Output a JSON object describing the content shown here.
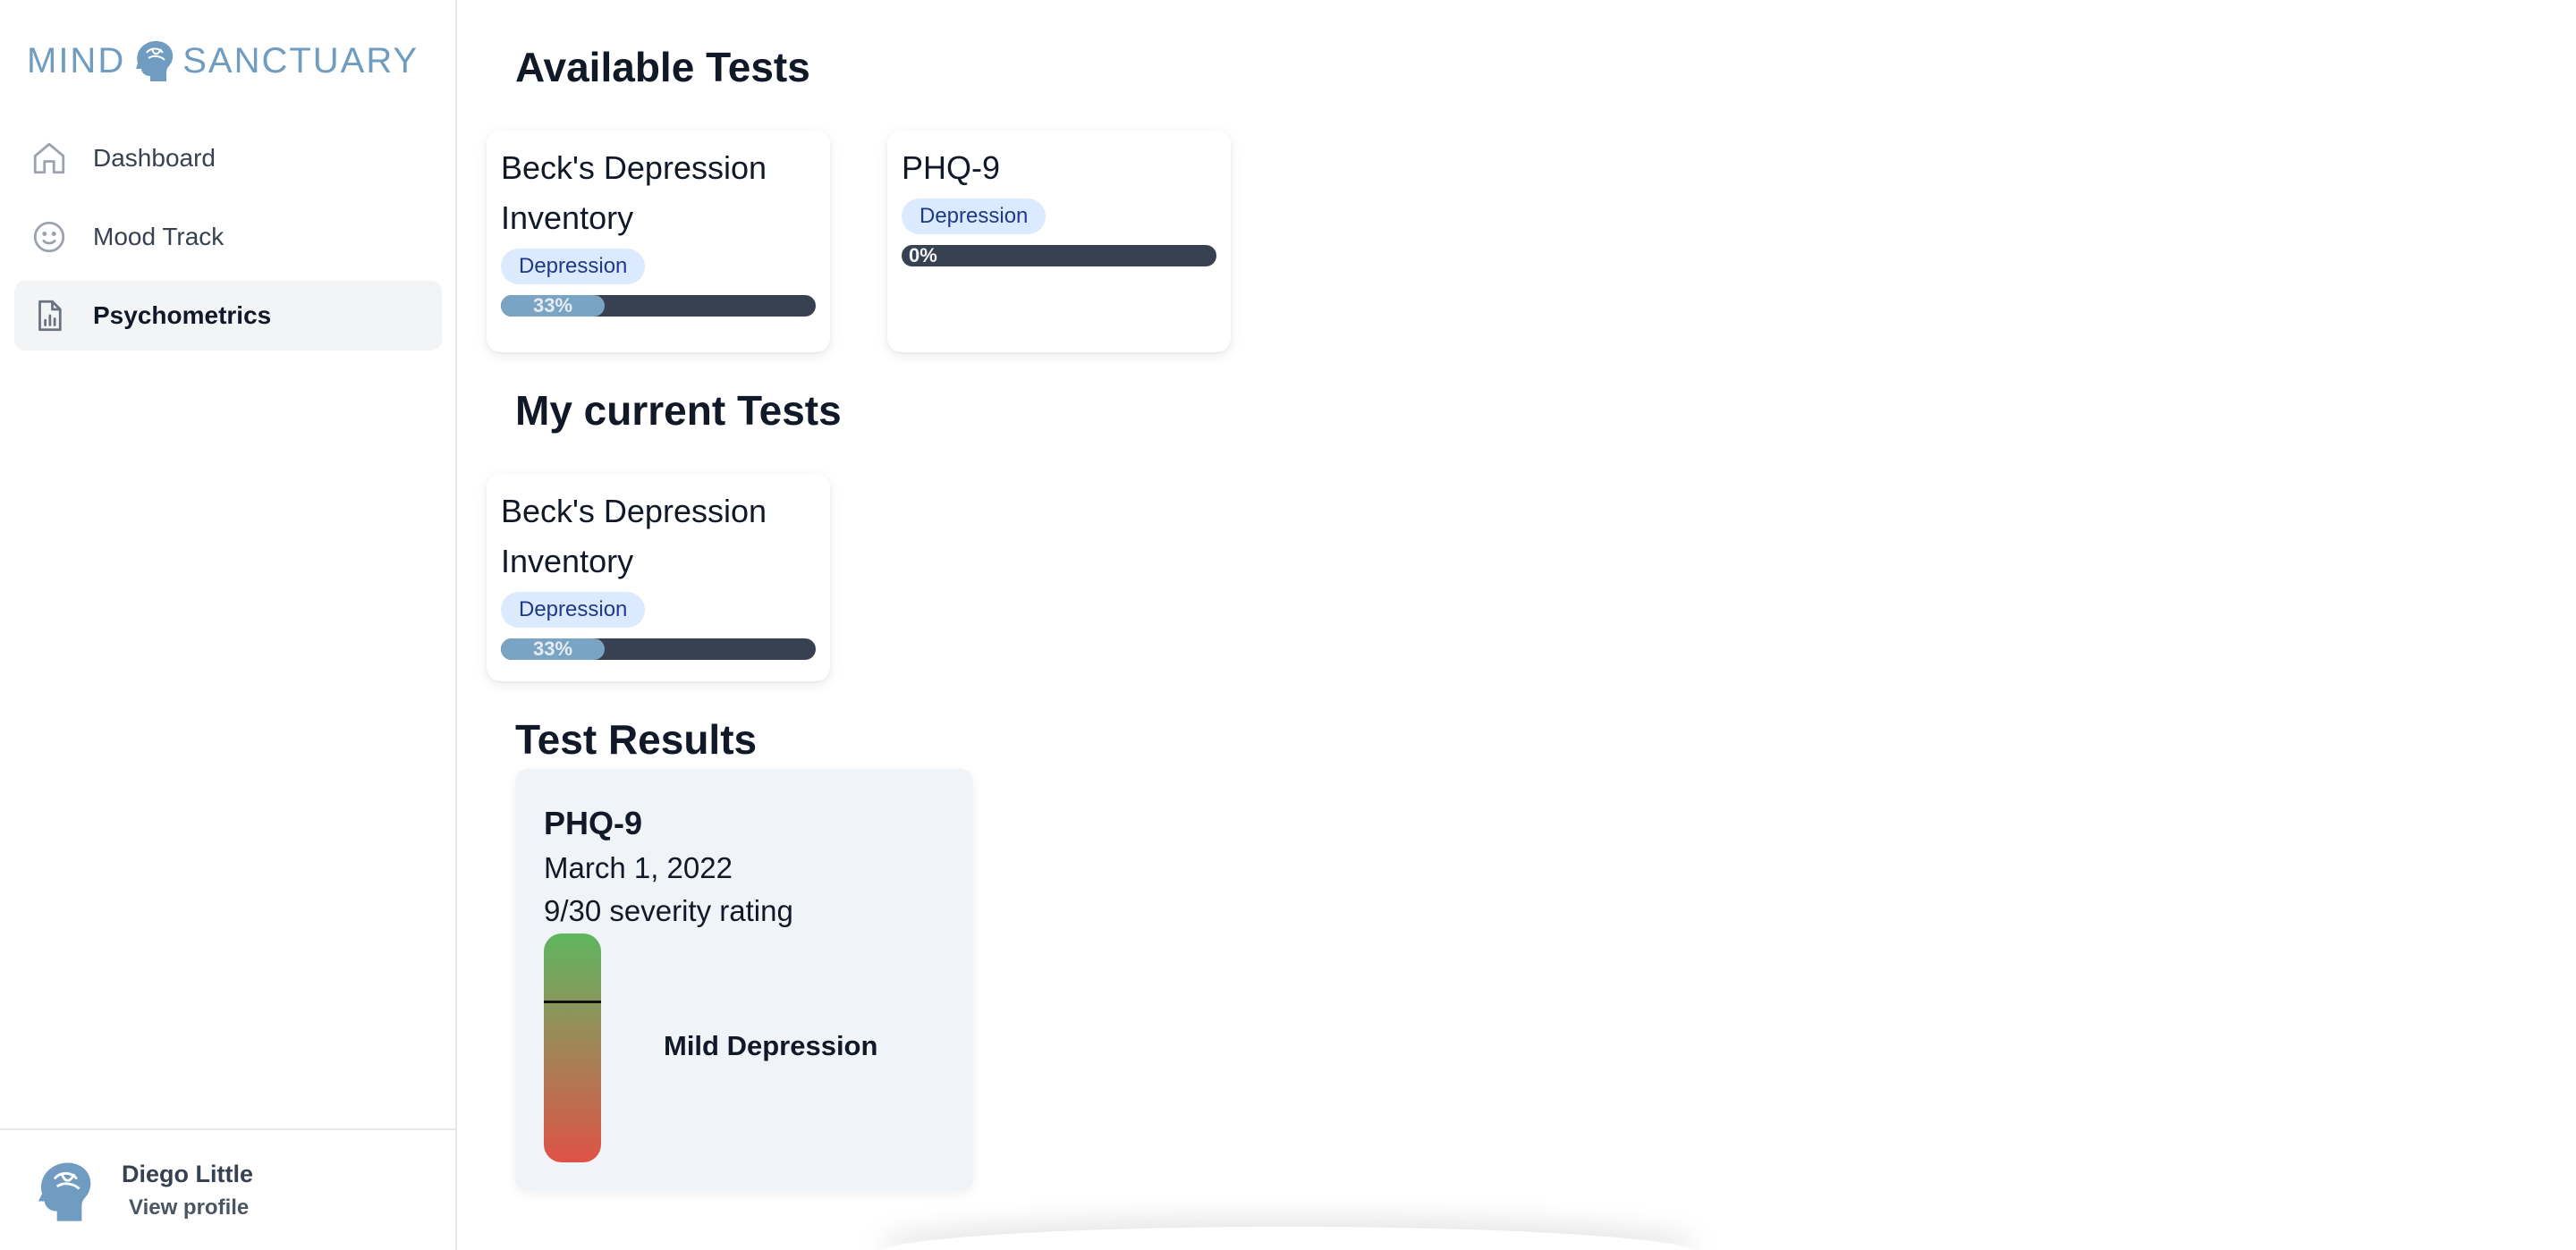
{
  "app": {
    "logo_left": "MIND",
    "logo_right": "SANCTUARY",
    "brand_color": "#6f9cc0"
  },
  "sidebar": {
    "items": [
      {
        "label": "Dashboard",
        "icon": "home-icon",
        "active": false
      },
      {
        "label": "Mood Track",
        "icon": "smiley-icon",
        "active": false
      },
      {
        "label": "Psychometrics",
        "icon": "chart-document-icon",
        "active": true
      }
    ]
  },
  "profile": {
    "name": "Diego Little",
    "link": "View profile"
  },
  "sections": {
    "available": "Available Tests",
    "current": "My current Tests",
    "results": "Test Results"
  },
  "available_tests": [
    {
      "title": "Beck's Depression Inventory",
      "tag": "Depression",
      "progress": 33,
      "progress_label": "33%"
    },
    {
      "title": "PHQ-9",
      "tag": "Depression",
      "progress": 0,
      "progress_label": "0%"
    }
  ],
  "current_tests": [
    {
      "title": "Beck's Depression Inventory",
      "tag": "Depression",
      "progress": 33,
      "progress_label": "33%"
    }
  ],
  "result": {
    "title": "PHQ-9",
    "date": "March 1, 2022",
    "score_text": "9/30 severity rating",
    "score": 9,
    "max": 30,
    "severity": "Mild Depression",
    "gauge_colors": {
      "top": "#5fb65f",
      "bottom": "#de5246"
    }
  },
  "colors": {
    "bar_track": "#374151",
    "bar_fill": "#7aa4c4",
    "badge_bg": "#dbeafe",
    "badge_text": "#1e3a8a"
  }
}
